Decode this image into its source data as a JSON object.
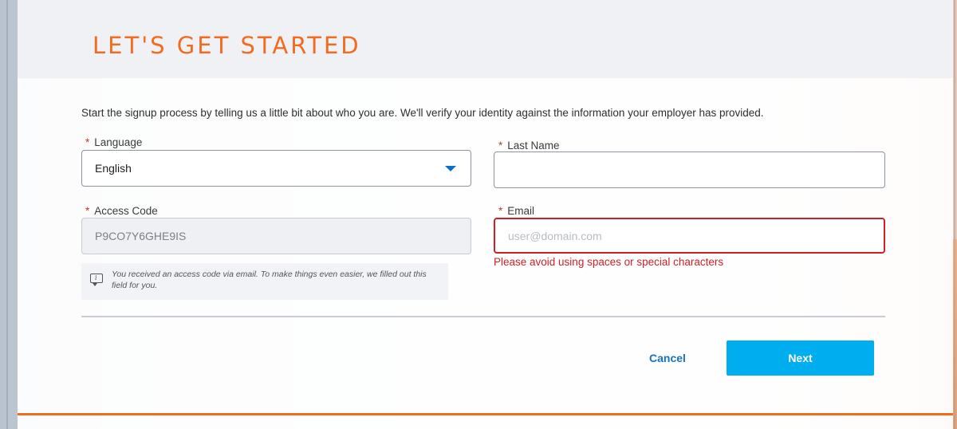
{
  "header": {
    "title": "LET'S GET STARTED"
  },
  "intro_text": "Start the signup process by telling us a little bit about who you are. We'll verify your identity against the information your employer has provided.",
  "required_marker": "*",
  "fields": {
    "language": {
      "label": "Language",
      "value": "English"
    },
    "last_name": {
      "label": "Last Name",
      "value": ""
    },
    "access_code": {
      "label": "Access Code",
      "value": "P9CO7Y6GHE9IS"
    },
    "email": {
      "label": "Email",
      "value": "",
      "placeholder": "user@domain.com",
      "error": "Please avoid using spaces or special characters"
    }
  },
  "hint": {
    "icon": "info-speech-bubble-icon",
    "text": "You received an access code via email. To make things even easier, we filled out this field for you."
  },
  "actions": {
    "cancel_label": "Cancel",
    "next_label": "Next"
  },
  "colors": {
    "accent": "#f26b21",
    "primary_button": "#00adef",
    "error": "#d21f26",
    "link": "#1773c2"
  }
}
